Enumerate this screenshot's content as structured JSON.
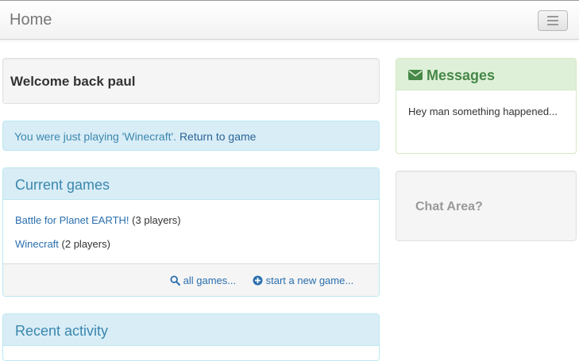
{
  "navbar": {
    "brand": "Home",
    "menu_icon": "hamburger-icon"
  },
  "welcome": {
    "text": "Welcome back paul"
  },
  "alert": {
    "text": "You were just playing 'Winecraft'.",
    "link": "Return to game",
    "color": "#3a87ad"
  },
  "current_games": {
    "title": "Current games",
    "games": [
      {
        "name": "Battle for Planet EARTH!",
        "players": "(3 players)"
      },
      {
        "name": "Winecraft",
        "players": "(2 players)"
      }
    ],
    "all_games": {
      "icon": "search-icon",
      "label": "all games..."
    },
    "new_game": {
      "icon": "plus-circle-icon",
      "label": "start a new game..."
    }
  },
  "recent_activity": {
    "title": "Recent activity"
  },
  "messages": {
    "icon": "envelope-icon",
    "title": "Messages",
    "body": "Hey man something happened...",
    "color": "#468847"
  },
  "chat": {
    "text": "Chat Area?"
  }
}
